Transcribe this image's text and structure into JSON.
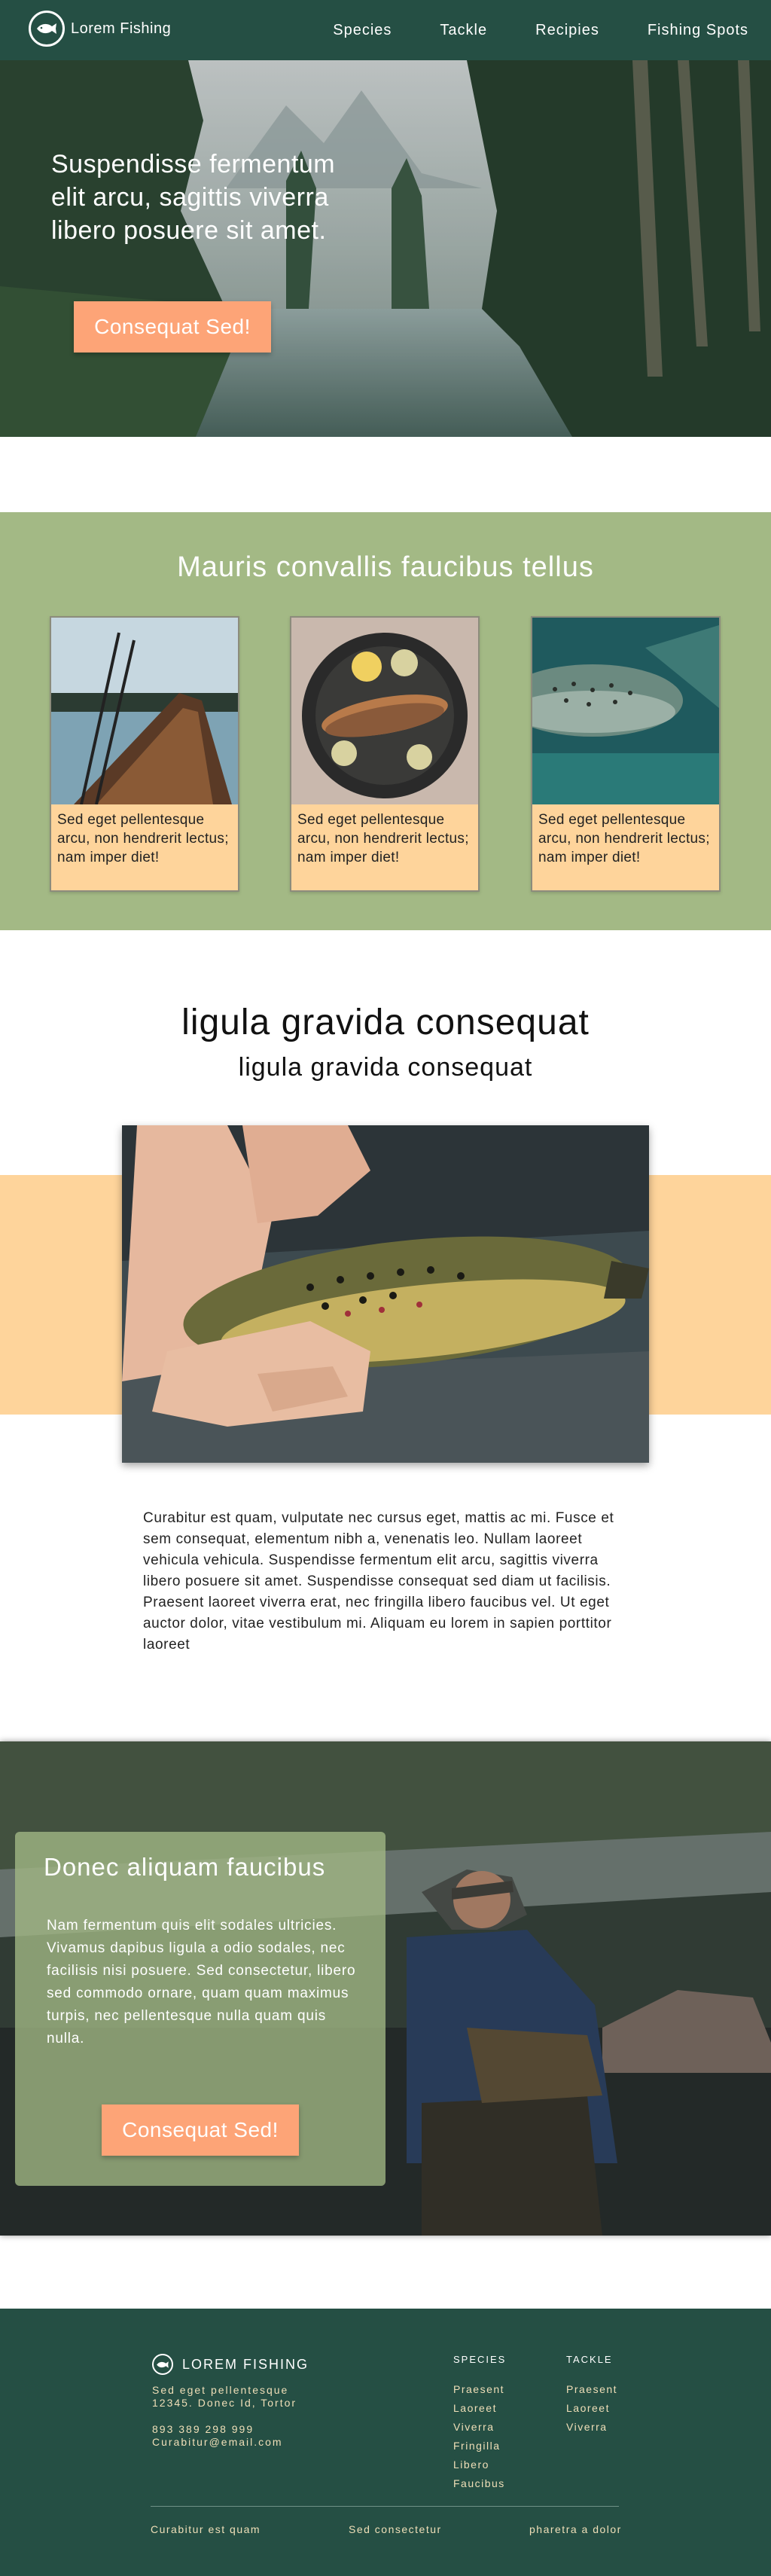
{
  "colors": {
    "nav_bg": "#254f44",
    "accent_orange": "#fda477",
    "section_green": "#a3b985",
    "peach": "#fed49b",
    "footer_text": "#f0dfb8"
  },
  "nav": {
    "brand": "Lorem Fishing",
    "logo_icon": "fish-logo-icon",
    "items": [
      {
        "label": "Species"
      },
      {
        "label": "Tackle"
      },
      {
        "label": "Recipies"
      },
      {
        "label": "Fishing Spots"
      }
    ]
  },
  "hero": {
    "text": "Suspendisse fermentum elit arcu, sagittis viverra libero posuere sit amet.",
    "button": "Consequat Sed!"
  },
  "features": {
    "title": "Mauris convallis faucibus tellus",
    "cards": [
      {
        "image": "canoe-on-lake",
        "caption": "Sed eget pellentesque arcu, non hendrerit lectus; nam imper diet!"
      },
      {
        "image": "cooked-fish-in-pan",
        "caption": "Sed eget pellentesque arcu, non hendrerit lectus; nam imper diet!"
      },
      {
        "image": "trout-underwater",
        "caption": "Sed eget pellentesque arcu, non hendrerit lectus; nam imper diet!"
      }
    ]
  },
  "article": {
    "heading": "ligula gravida consequat",
    "subheading": "ligula gravida consequat",
    "image": "hand-holding-trout",
    "body": "Curabitur est quam, vulputate nec cursus eget, mattis ac mi. Fusce et sem consequat, elementum nibh a, venenatis leo. Nullam laoreet vehicula vehicula. Suspendisse fermentum elit arcu, sagittis viverra libero posuere sit amet. Suspendisse consequat sed diam ut facilisis. Praesent laoreet viverra erat, nec fringilla libero faucibus vel. Ut eget auctor dolor, vitae vestibulum mi. Aliquam eu lorem in sapien porttitor laoreet"
  },
  "promo": {
    "title": "Donec aliquam faucibus",
    "body": "Nam fermentum quis elit sodales ultricies. Vivamus dapibus ligula a odio sodales, nec facilisis nisi posuere. Sed consectetur, libero sed commodo ornare, quam quam maximus turpis, nec pellentesque nulla quam quis nulla.",
    "button": "Consequat Sed!",
    "image": "fly-fisherman-in-river"
  },
  "footer": {
    "brand": "LOREM FISHING",
    "address_line1": "Sed eget pellentesque",
    "address_line2": "12345. Donec Id, Tortor",
    "phone": "893 389 298 999",
    "email": "Curabitur@email.com",
    "species": {
      "heading": "SPECIES",
      "items": [
        "Praesent",
        "Laoreet",
        "Viverra",
        "Fringilla",
        "Libero",
        "Faucibus"
      ]
    },
    "tackle": {
      "heading": "TACKLE",
      "items": [
        "Praesent",
        "Laoreet",
        "Viverra"
      ]
    },
    "bottom_links": [
      "Curabitur est quam",
      "Sed consectetur",
      "pharetra a dolor"
    ]
  }
}
